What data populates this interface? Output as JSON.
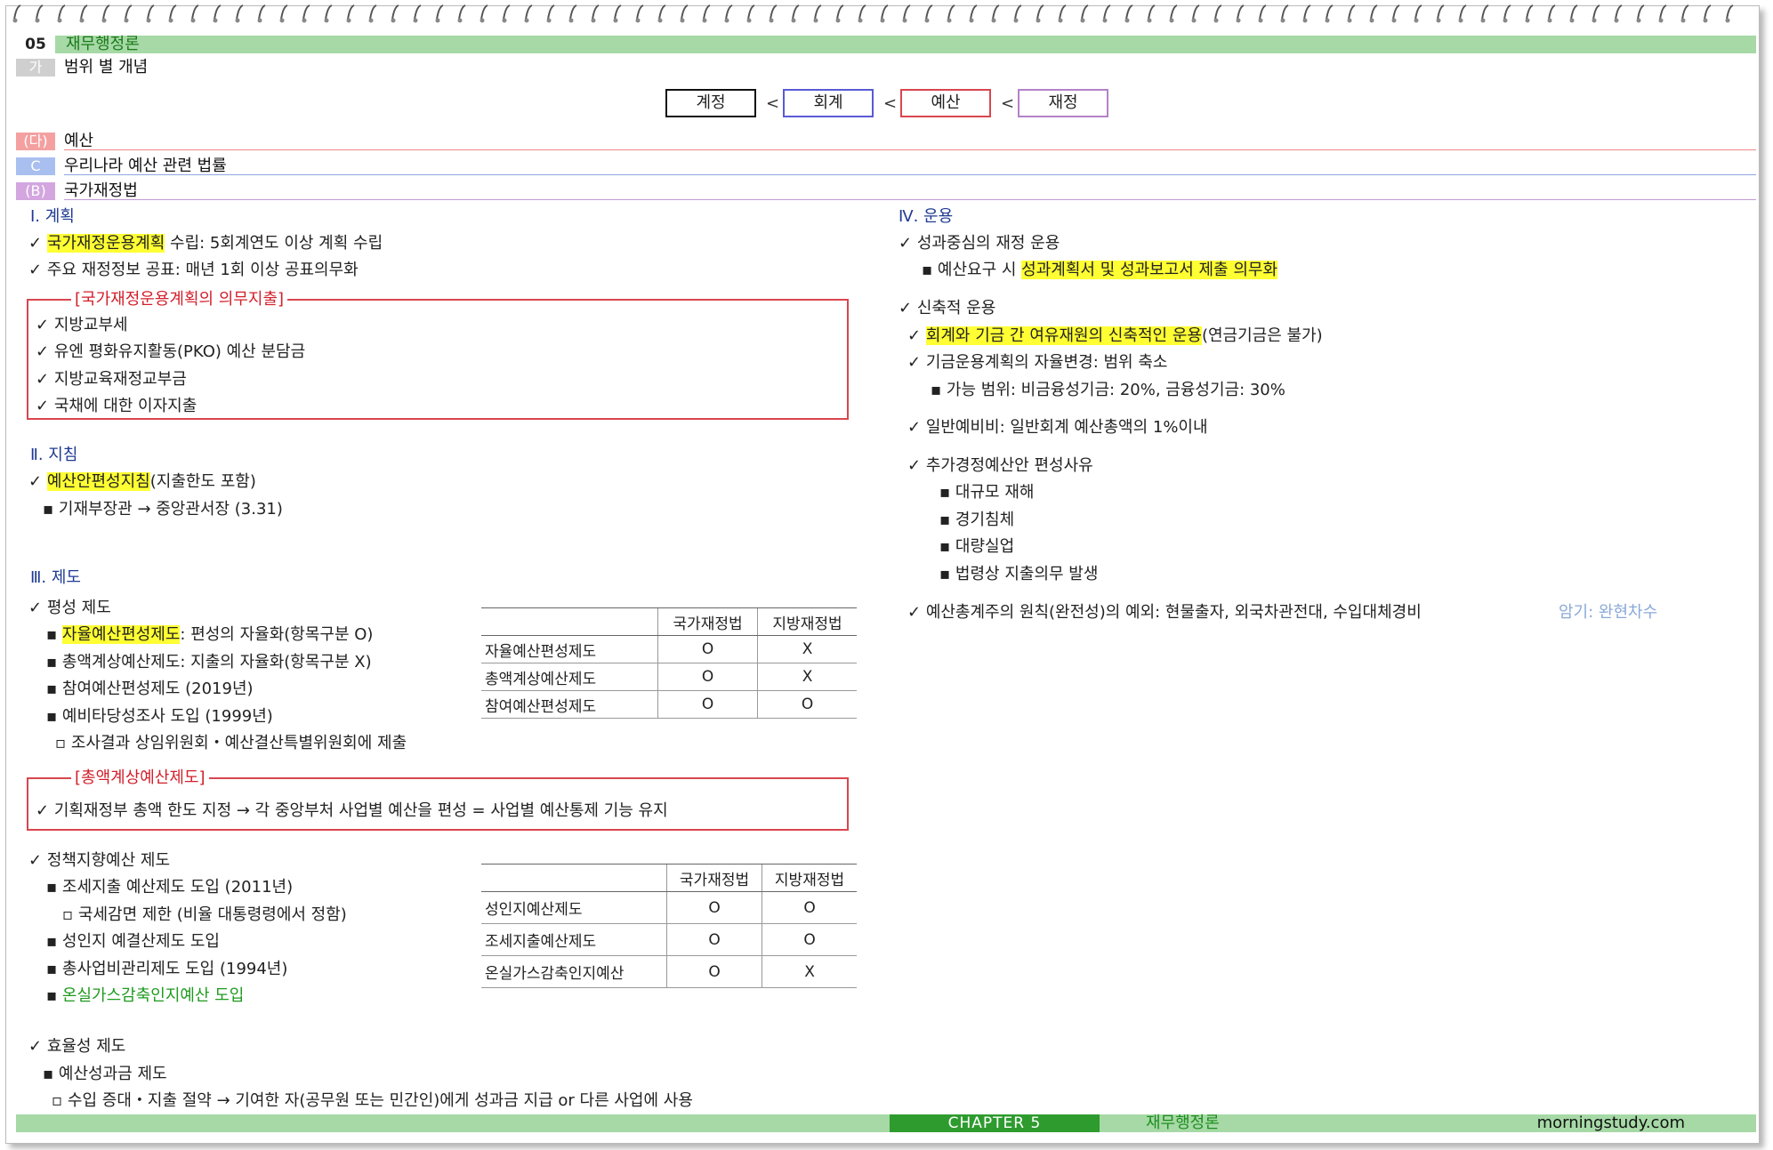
{
  "header": {
    "chapter_num": "05",
    "chapter_title": "재무행정론",
    "section_tag": "가",
    "section_title": "범위 별 개념"
  },
  "hierarchy": [
    "계정",
    "회계",
    "예산",
    "재정"
  ],
  "hierarchy_sep": "<",
  "subheads": [
    {
      "tag": "(다)",
      "title": "예산"
    },
    {
      "tag": "C",
      "title": "우리나라 예산 관련 법률"
    },
    {
      "tag": "(B)",
      "title": "국가재정법"
    }
  ],
  "left": {
    "s1": {
      "title": "Ⅰ. 계획",
      "l1_hl": "국가재정운용계획",
      "l1_rest": " 수립: 5회계연도 이상 계획 수립",
      "l2": "주요 재정정보 공표: 매년 1회 이상 공표의무화",
      "box_title": "[국가재정운용계획의 의무지출]",
      "box_items": [
        "지방교부세",
        "유엔 평화유지활동(PKO) 예산 분담금",
        "지방교육재정교부금",
        "국채에 대한 이자지출"
      ]
    },
    "s2": {
      "title": "Ⅱ. 지침",
      "l1_hl": "예산안편성지침",
      "l1_rest": "(지출한도 포함)",
      "l2": "기재부장관 → 중앙관서장 (3.31)"
    },
    "s3": {
      "title": "Ⅲ. 제도",
      "g1": "평성 제도",
      "g1_i1_hl": "자율예산편성제도",
      "g1_i1_rest": ": 편성의 자율화(항목구분 O)",
      "g1_i2": "총액계상예산제도: 지출의 자율화(항목구분 X)",
      "g1_i3": "참여예산편성제도 (2019년)",
      "g1_i4": "예비타당성조사 도입 (1999년)",
      "g1_i4_sub": "조사결과 상임위원회・예산결산특별위원회에 제출",
      "box_title": "[총액계상예산제도]",
      "box_item": "기획재정부 총액 한도 지정 → 각 중앙부처 사업별 예산을 편성 = 사업별 예산통제 기능 유지",
      "g2": "정책지향예산 제도",
      "g2_i1": "조세지출 예산제도 도입 (2011년)",
      "g2_i1_sub": "국세감면 제한 (비율 대통령령에서 정함)",
      "g2_i2": "성인지 예결산제도 도입",
      "g2_i3": "총사업비관리제도 도입 (1994년)",
      "g2_i4": "온실가스감축인지예산 도입",
      "g3": "효율성 제도",
      "g3_i1": "예산성과금 제도",
      "g3_i1_sub": "수입 증대・지출 절약 → 기여한 자(공무원 또는 민간인)에게 성과금 지급 or 다른 사업에 사용"
    },
    "table1": {
      "headers": [
        "",
        "국가재정법",
        "지방재정법"
      ],
      "rows": [
        [
          "자율예산편성제도",
          "O",
          "X"
        ],
        [
          "총액계상예산제도",
          "O",
          "X"
        ],
        [
          "참여예산편성제도",
          "O",
          "O"
        ]
      ]
    },
    "table2": {
      "headers": [
        "",
        "국가재정법",
        "지방재정법"
      ],
      "rows": [
        [
          "성인지예산제도",
          "O",
          "O"
        ],
        [
          "조세지출예산제도",
          "O",
          "O"
        ],
        [
          "온실가스감축인지예산",
          "O",
          "X"
        ]
      ]
    }
  },
  "right": {
    "title": "Ⅳ. 운용",
    "g1": "성과중심의 재정 운용",
    "g1_i1_pre": "예산요구 시 ",
    "g1_i1_hl": "성과계획서 및 성과보고서 제출 의무화",
    "g2": "신축적 운용",
    "g2_i1_hl": "회계와 기금 간 여유재원의 신축적인 운용",
    "g2_i1_rest": "(연금기금은 불가)",
    "g2_i2": "기금운용계획의 자율변경: 범위 축소",
    "g2_i2_sub": "가능 범위: 비금융성기금: 20%, 금융성기금: 30%",
    "g3": "일반예비비: 일반회계 예산총액의 1%이내",
    "g4": "추가경정예산안 편성사유",
    "g4_items": [
      "대규모 재해",
      "경기침체",
      "대량실업",
      "법령상 지출의무 발생"
    ],
    "g5": "예산총계주의 원칙(완전성)의 예외: 현물출자, 외국차관전대, 수입대체경비",
    "g5_hint": "암기: 완현차수"
  },
  "footer": {
    "chapter": "CHAPTER 5",
    "subject": "재무행정론",
    "site": "morningstudy.com"
  },
  "colors": {
    "green_bar": "#a6d9a6",
    "green_dark": "#2e9b2e",
    "highlight": "#ffff33",
    "callout_red": "#d9464f",
    "subhead_pink": "#f4a0a0",
    "subhead_blue": "#a9bff0",
    "subhead_purple": "#d3a6e0"
  }
}
